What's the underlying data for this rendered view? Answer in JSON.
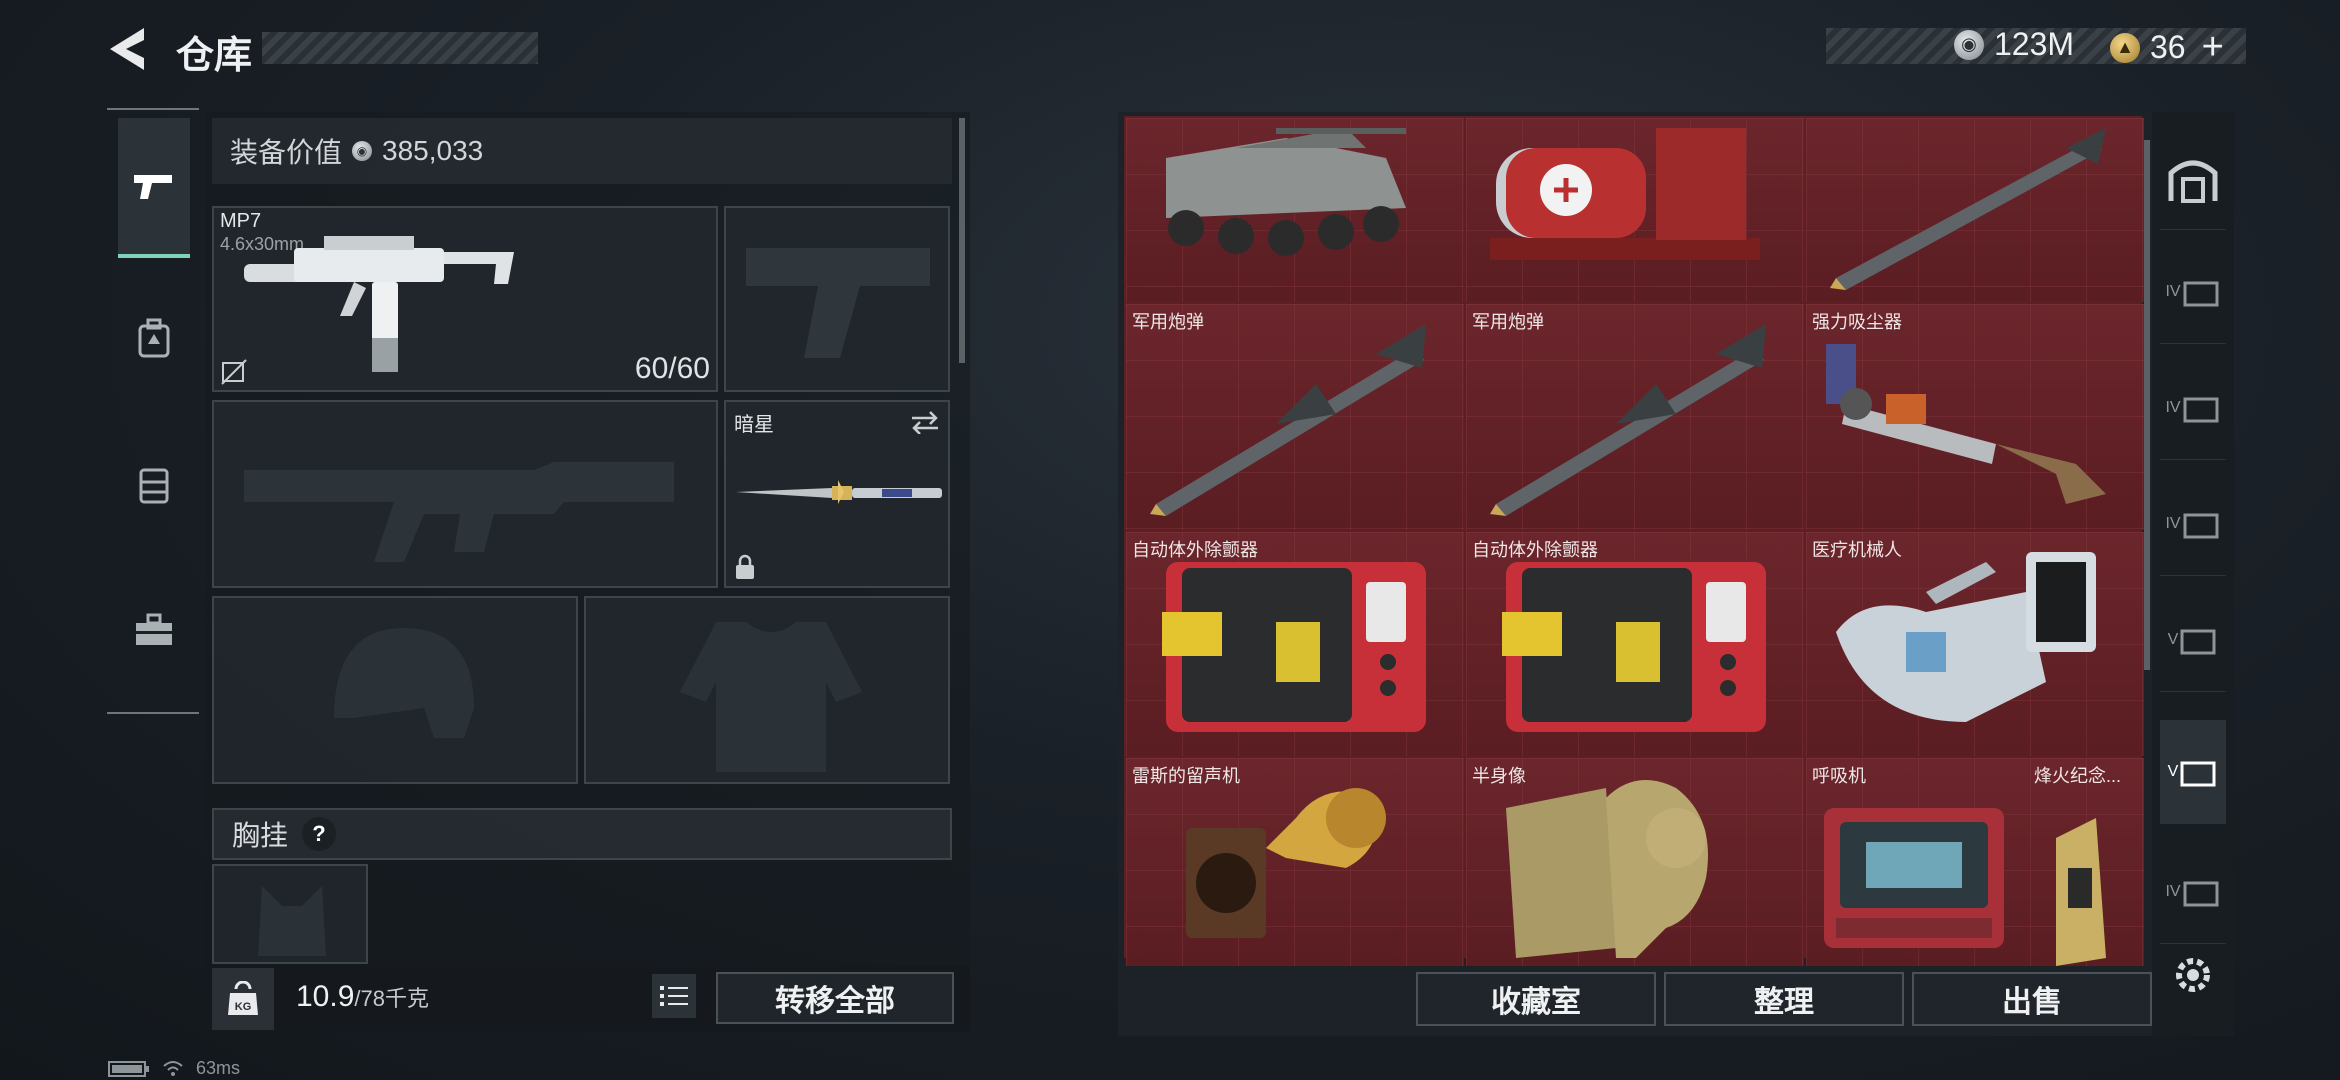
{
  "header": {
    "title": "仓库"
  },
  "currency": {
    "silver": "123M",
    "gold": "36",
    "plus": "+"
  },
  "loadout": {
    "value_label": "装备价值",
    "value": "385,033",
    "primary": {
      "name": "MP7",
      "caliber": "4.6x30mm",
      "ammo": "60/60"
    },
    "melee": {
      "name": "暗星"
    },
    "chest_label": "胸挂",
    "help": "?",
    "weight": "10.9",
    "weight_max": "/78千克",
    "transfer_all": "转移全部"
  },
  "storage": {
    "items": [
      {
        "label": ""
      },
      {
        "label": ""
      },
      {
        "label": ""
      },
      {
        "label": "军用炮弹"
      },
      {
        "label": "军用炮弹"
      },
      {
        "label": "强力吸尘器"
      },
      {
        "label": "自动体外除颤器"
      },
      {
        "label": "自动体外除颤器"
      },
      {
        "label": "医疗机械人"
      },
      {
        "label": "雷斯的留声机"
      },
      {
        "label": "半身像"
      },
      {
        "label": "呼吸机"
      },
      {
        "label": "烽火纪念..."
      }
    ],
    "buttons": {
      "collection": "收藏室",
      "sort": "整理",
      "sell": "出售"
    }
  },
  "category_tabs": [
    "IV",
    "IV",
    "IV",
    "V",
    "V",
    "IV"
  ],
  "status": {
    "ping": "63ms"
  },
  "colors": {
    "accent": "#7fd4b7",
    "storage_bg": "#5c1f24"
  },
  "icons": [
    "back-arrow-icon",
    "pistol-icon",
    "backpack-icon",
    "vest-icon",
    "toolbox-icon",
    "kg-icon",
    "list-icon",
    "lock-icon",
    "swap-icon",
    "settings-icon",
    "helmet-icon",
    "armor-icon",
    "rifle-icon"
  ]
}
